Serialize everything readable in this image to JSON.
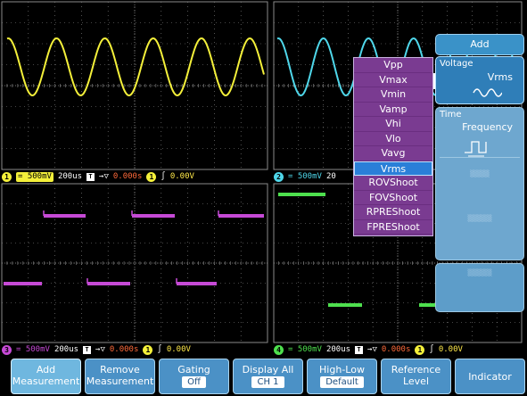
{
  "waveform": {
    "ch1_cycles_visible": 5.5,
    "ch2_cycles_visible": 5.5,
    "ch3_pattern": "square-high-low",
    "ch4_pattern": "square-low-high",
    "colors": {
      "ch1": "#f4f03a",
      "ch2": "#4fd7ea",
      "ch3": "#c64ad6",
      "ch4": "#4ee04e",
      "grid": "#8a8a8a",
      "panel": "#3f8fc6",
      "menu": "#7a3b91",
      "highlight": "#2a7fd8",
      "status_orange": "#ff6a3a"
    }
  },
  "status": {
    "ch1": {
      "num": "1",
      "volts": "500mV",
      "time": "200us",
      "trig": "T",
      "offset": "0.000s",
      "trig_level": "0.00V"
    },
    "ch2": {
      "num": "2",
      "volts": "500mV",
      "time": "20"
    },
    "ch3": {
      "num": "3",
      "volts": "500mV",
      "time": "200us",
      "trig": "T",
      "offset": "0.000s",
      "trig_level": "0.00V"
    },
    "ch4": {
      "num": "4",
      "volts": "500mV",
      "time": "200us",
      "trig": "T",
      "offset": "0.000s",
      "trig_level": "0.00V"
    }
  },
  "measure_menu": {
    "items": [
      "Vpp",
      "Vmax",
      "Vmin",
      "Vamp",
      "Vhi",
      "Vlo",
      "Vavg",
      "Vrms",
      "ROVShoot",
      "FOVShoot",
      "RPREShoot",
      "FPREShoot"
    ],
    "selected": "Vrms"
  },
  "side_panel": {
    "title": "Add",
    "voltage_label": "Voltage",
    "voltage_value": "Vrms",
    "time_label": "Time",
    "time_value": "Frequency",
    "voltage_icon": "sine-wave-icon",
    "time_icon": "square-pulse-icon"
  },
  "softkeys": [
    {
      "line1": "Add",
      "line2": "Measurement"
    },
    {
      "line1": "Remove",
      "line2": "Measurement"
    },
    {
      "line1": "Gating",
      "sub": "Off"
    },
    {
      "line1": "Display All",
      "sub": "CH 1"
    },
    {
      "line1": "High-Low",
      "sub": "Default"
    },
    {
      "line1": "Reference",
      "line2": "Level"
    },
    {
      "line1": "Indicator"
    }
  ]
}
